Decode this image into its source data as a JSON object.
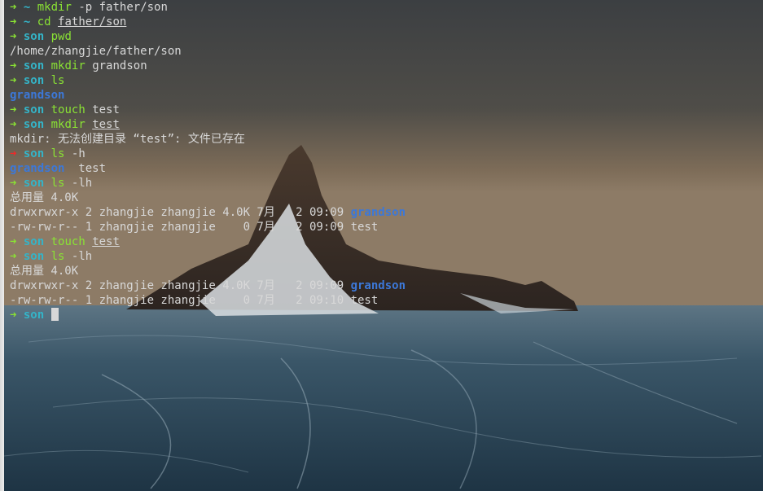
{
  "terminal": {
    "lines": [
      {
        "type": "prompt",
        "arrow": "➜",
        "status": "ok",
        "dir": "~",
        "cmd": "mkdir",
        "args": "-p father/son",
        "args_underline": false
      },
      {
        "type": "prompt",
        "arrow": "➜",
        "status": "ok",
        "dir": "~",
        "cmd": "cd",
        "args": "father/son",
        "args_underline": true
      },
      {
        "type": "prompt",
        "arrow": "➜",
        "status": "ok",
        "dir": "son",
        "cmd": "pwd",
        "args": "",
        "args_underline": false
      },
      {
        "type": "output",
        "text": "/home/zhangjie/father/son"
      },
      {
        "type": "prompt",
        "arrow": "➜",
        "status": "ok",
        "dir": "son",
        "cmd": "mkdir",
        "args": "grandson",
        "args_underline": false
      },
      {
        "type": "prompt",
        "arrow": "➜",
        "status": "ok",
        "dir": "son",
        "cmd": "ls",
        "args": "",
        "args_underline": false
      },
      {
        "type": "listing",
        "items": [
          {
            "text": "grandson",
            "kind": "dir"
          }
        ]
      },
      {
        "type": "prompt",
        "arrow": "➜",
        "status": "ok",
        "dir": "son",
        "cmd": "touch",
        "args": "test",
        "args_underline": false
      },
      {
        "type": "prompt",
        "arrow": "➜",
        "status": "ok",
        "dir": "son",
        "cmd": "mkdir",
        "args": "test",
        "args_underline": true
      },
      {
        "type": "output",
        "text": "mkdir: 无法创建目录 “test”: 文件已存在"
      },
      {
        "type": "prompt",
        "arrow": "➜",
        "status": "err",
        "dir": "son",
        "cmd": "ls",
        "args": "-h",
        "args_underline": false
      },
      {
        "type": "listing",
        "items": [
          {
            "text": "grandson",
            "kind": "dir"
          },
          {
            "text": "  test",
            "kind": "file"
          }
        ]
      },
      {
        "type": "prompt",
        "arrow": "➜",
        "status": "ok",
        "dir": "son",
        "cmd": "ls",
        "args": "-lh",
        "args_underline": false
      },
      {
        "type": "output",
        "text": "总用量 4.0K"
      },
      {
        "type": "lsrow",
        "prefix": "drwxrwxr-x 2 zhangjie zhangjie 4.0K 7月   2 09:09 ",
        "name": "grandson",
        "kind": "dir"
      },
      {
        "type": "lsrow",
        "prefix": "-rw-rw-r-- 1 zhangjie zhangjie    0 7月   2 09:09 ",
        "name": "test",
        "kind": "file"
      },
      {
        "type": "prompt",
        "arrow": "➜",
        "status": "ok",
        "dir": "son",
        "cmd": "touch",
        "args": "test",
        "args_underline": true
      },
      {
        "type": "prompt",
        "arrow": "➜",
        "status": "ok",
        "dir": "son",
        "cmd": "ls",
        "args": "-lh",
        "args_underline": false
      },
      {
        "type": "output",
        "text": "总用量 4.0K"
      },
      {
        "type": "lsrow",
        "prefix": "drwxrwxr-x 2 zhangjie zhangjie 4.0K 7月   2 09:09 ",
        "name": "grandson",
        "kind": "dir"
      },
      {
        "type": "lsrow",
        "prefix": "-rw-rw-r-- 1 zhangjie zhangjie    0 7月   2 09:10 ",
        "name": "test",
        "kind": "file"
      },
      {
        "type": "current",
        "arrow": "➜",
        "status": "ok",
        "dir": "son"
      }
    ]
  },
  "colors": {
    "prompt_ok": "#8ae234",
    "prompt_err": "#ef2929",
    "dir_prompt": "#34b4c8",
    "dir_listing": "#3c78d8",
    "text": "#d8d8d8"
  }
}
